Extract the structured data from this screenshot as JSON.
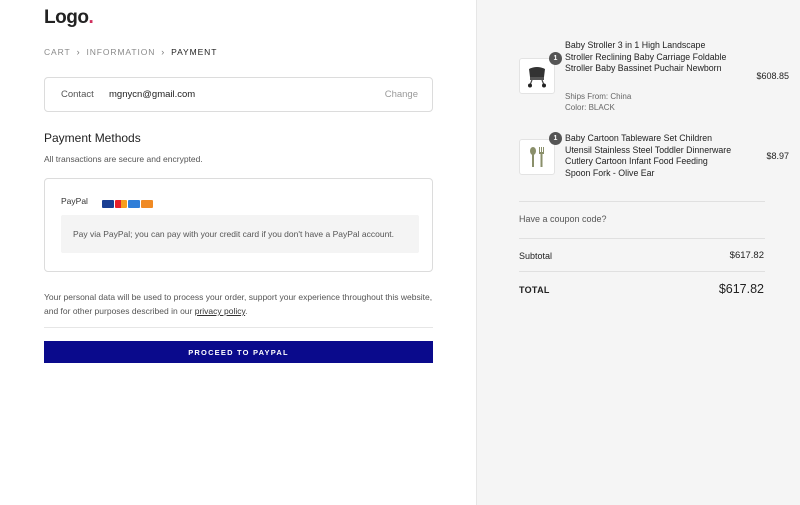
{
  "logo": {
    "text": "Logo",
    "dot": "."
  },
  "breadcrumb": {
    "items": [
      "CART",
      "INFORMATION",
      "PAYMENT"
    ],
    "separator": "›"
  },
  "contact": {
    "label": "Contact",
    "value": "mgnycn@gmail.com",
    "change_label": "Change"
  },
  "payment": {
    "title": "Payment Methods",
    "subtitle": "All transactions are secure and encrypted.",
    "method_label": "PayPal",
    "description": "Pay via PayPal; you can pay with your credit card if you don't have a PayPal account."
  },
  "privacy": {
    "text": "Your personal data will be used to process your order, support your experience throughout this website, and for other purposes described in our ",
    "link": "privacy policy",
    "end": "."
  },
  "proceed_label": "PROCEED TO PAYPAL",
  "cart": {
    "items": [
      {
        "quantity": "1",
        "name": "Baby Stroller 3 in 1 High Landscape Stroller Reclining Baby Carriage Foldable Stroller Baby Bassinet Puchair Newborn",
        "meta": [
          {
            "key": "Ships From:",
            "value": "China"
          },
          {
            "key": "Color:",
            "value": "BLACK"
          }
        ],
        "price": "$608.85",
        "icon": "stroller-icon"
      },
      {
        "quantity": "1",
        "name": "Baby Cartoon Tableware Set Children Utensil Stainless Steel Toddler Dinnerware Cutlery Cartoon Infant Food Feeding Spoon Fork - Olive Ear",
        "meta": [],
        "price": "$8.97",
        "icon": "cutlery-icon"
      }
    ],
    "coupon_label": "Have a coupon code?",
    "subtotal_label": "Subtotal",
    "subtotal_value": "$617.82",
    "total_label": "TOTAL",
    "total_value": "$617.82"
  },
  "colors": {
    "accent": "#0a0a8c",
    "logo_dot": "#d0305e",
    "sidebar_bg": "#f5f5f5"
  }
}
